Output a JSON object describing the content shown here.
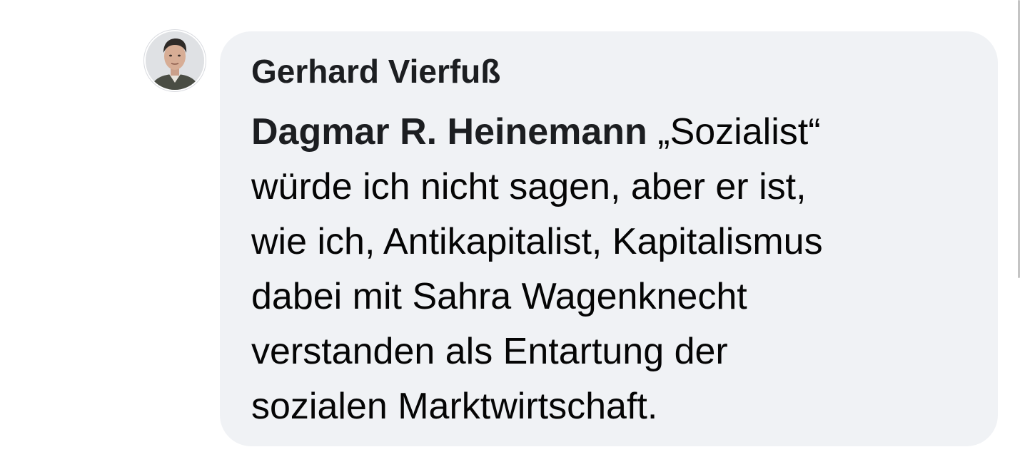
{
  "comment": {
    "author": "Gerhard Vierfuß",
    "avatar_icon": "profile-photo-avatar",
    "mention": "Dagmar R. Heinemann",
    "lines": [
      " „Sozialist“",
      "würde ich nicht sagen, aber er ist,",
      "wie ich, Antikapitalist, Kapitalismus",
      "dabei mit Sahra Wagenknecht",
      "verstanden als Entartung der",
      "sozialen Marktwirtschaft."
    ]
  },
  "colors": {
    "bubble": "#f0f2f5",
    "text": "#050505",
    "author": "#1c1e21"
  }
}
